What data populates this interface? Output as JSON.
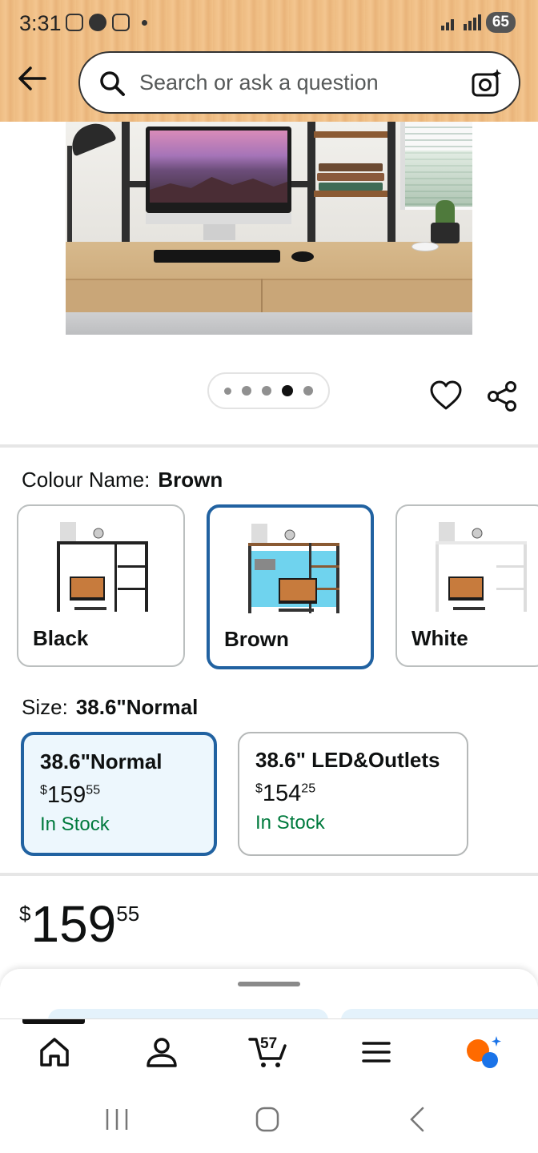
{
  "status_bar": {
    "time": "3:31",
    "battery": "65"
  },
  "search": {
    "placeholder": "Search or ask a question"
  },
  "gallery": {
    "image_count": 5,
    "active_index": 3
  },
  "colour": {
    "label": "Colour Name:",
    "selected": "Brown",
    "options": [
      {
        "name": "Black"
      },
      {
        "name": "Brown"
      },
      {
        "name": "White"
      }
    ]
  },
  "size": {
    "label": "Size:",
    "selected": "38.6\"Normal",
    "options": [
      {
        "name": "38.6\"Normal",
        "currency": "$",
        "whole": "159",
        "fraction": "55",
        "stock": "In Stock"
      },
      {
        "name": "38.6\" LED&Outlets",
        "currency": "$",
        "whole": "154",
        "fraction": "25",
        "stock": "In Stock"
      }
    ]
  },
  "price": {
    "currency": "$",
    "whole": "159",
    "fraction": "55"
  },
  "bottom_nav": {
    "cart_count": "57"
  },
  "colors": {
    "selected_border": "#2162a1",
    "in_stock": "#007a3d",
    "header_bg": "#eebc82"
  }
}
